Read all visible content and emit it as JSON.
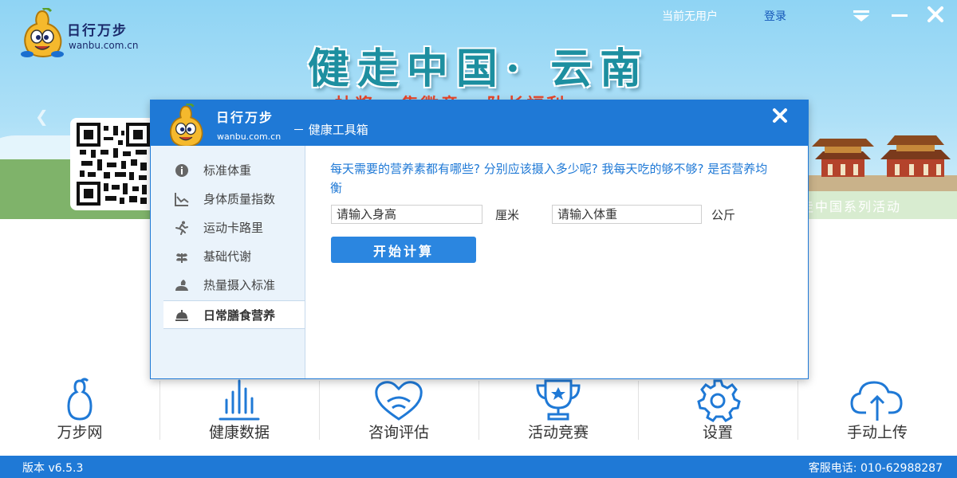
{
  "app": {
    "brand": "日行万步",
    "domain": "wanbu.com.cn",
    "user_status": "当前无用户",
    "login_label": "登录"
  },
  "banner": {
    "title": "健走中国· 云南",
    "subtitle": "抽奖 · 集徽章 · 队长福利",
    "right_text": "走中国系列活动"
  },
  "dialog": {
    "brand": "日行万步",
    "brand_sub": "wanbu.com.cn",
    "title": "－ 健康工具箱",
    "sidebar": [
      {
        "label": "标准体重",
        "icon": "info-icon"
      },
      {
        "label": "身体质量指数",
        "icon": "chart-line-icon"
      },
      {
        "label": "运动卡路里",
        "icon": "running-icon"
      },
      {
        "label": "基础代谢",
        "icon": "leaf-icon"
      },
      {
        "label": "热量摄入标准",
        "icon": "food-icon"
      },
      {
        "label": "日常膳食营养",
        "icon": "dish-icon",
        "active": true
      }
    ],
    "question": "每天需要的营养素都有哪些? 分别应该摄入多少呢? 我每天吃的够不够? 是否营养均衡",
    "height_placeholder": "请输入身高",
    "height_unit": "厘米",
    "weight_placeholder": "请输入体重",
    "weight_unit": "公斤",
    "calc_button": "开始计算"
  },
  "nav": [
    {
      "label": "万步网",
      "icon": "gourd-icon"
    },
    {
      "label": "健康数据",
      "icon": "bar-chart-icon"
    },
    {
      "label": "咨询评估",
      "icon": "heart-chat-icon"
    },
    {
      "label": "活动竞赛",
      "icon": "trophy-icon"
    },
    {
      "label": "设置",
      "icon": "gear-icon"
    },
    {
      "label": "手动上传",
      "icon": "cloud-upload-icon"
    }
  ],
  "status_bar": {
    "version": "版本 v6.5.3",
    "hotline": "客服电话: 010-62988287"
  },
  "colors": {
    "primary": "#1f79d6",
    "accent_red": "#e8462a",
    "title_teal": "#1d8fa0"
  }
}
